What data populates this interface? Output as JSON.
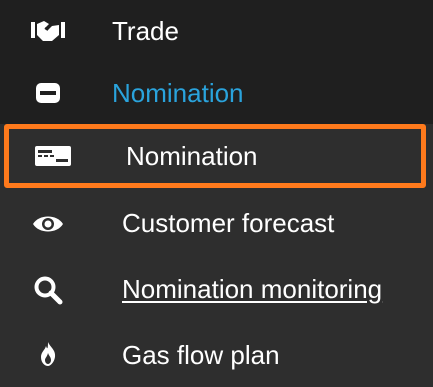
{
  "colors": {
    "accent": "#2aa3dc",
    "selection_border": "#ff7a1c",
    "background": "#2e2e2e",
    "top_row_background": "#1f1f1f",
    "text": "#ffffff"
  },
  "menu": {
    "trade": {
      "label": "Trade",
      "icon": "handshake-icon"
    },
    "nomination_group": {
      "label": "Nomination",
      "icon": "card-icon"
    },
    "items": [
      {
        "label": "Nomination",
        "icon": "id-card-icon",
        "selected": true,
        "underlined": false
      },
      {
        "label": "Customer forecast",
        "icon": "eye-icon",
        "selected": false,
        "underlined": false
      },
      {
        "label": "Nomination monitoring",
        "icon": "search-icon",
        "selected": false,
        "underlined": true
      },
      {
        "label": "Gas flow plan",
        "icon": "flame-icon",
        "selected": false,
        "underlined": false
      }
    ]
  }
}
